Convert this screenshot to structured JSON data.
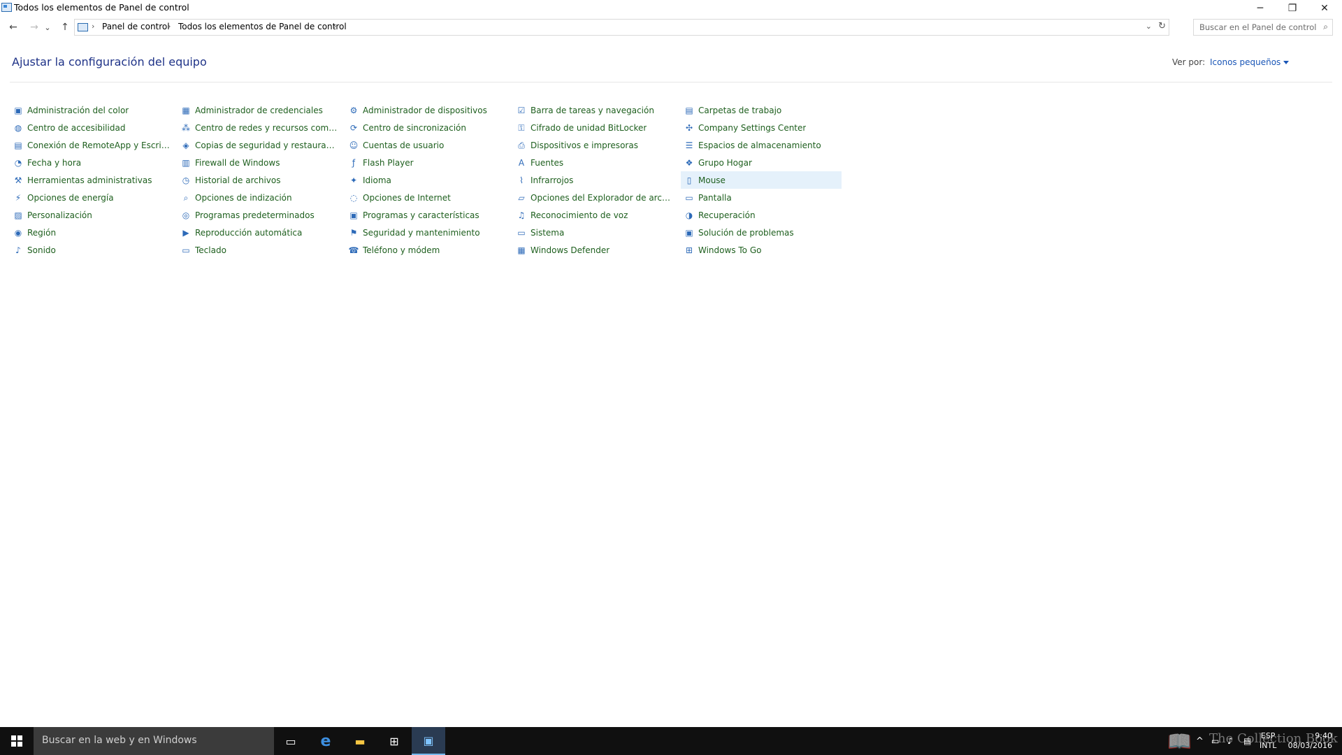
{
  "window": {
    "title": "Todos los elementos de Panel de control",
    "controls": {
      "minimize": "─",
      "maximize": "❐",
      "close": "✕"
    }
  },
  "nav": {
    "back": "←",
    "forward": "→",
    "recent": "⌄",
    "up": "↑",
    "breadcrumb": [
      "Panel de control",
      "Todos los elementos de Panel de control"
    ],
    "separator": "›",
    "dropdown": "⌄",
    "refresh": "↻",
    "search_placeholder": "Buscar en el Panel de control",
    "search_icon": "⌕"
  },
  "content": {
    "heading": "Ajustar la configuración del equipo",
    "view_by_label": "Ver por:",
    "view_by_value": "Iconos pequeños"
  },
  "items": {
    "col1": [
      {
        "label": "Administración del color",
        "icon": "color-management-icon",
        "glyph": "▣"
      },
      {
        "label": "Centro de accesibilidad",
        "icon": "accessibility-icon",
        "glyph": "◍"
      },
      {
        "label": "Conexión de RemoteApp y Escritorio",
        "icon": "remoteapp-icon",
        "glyph": "▤"
      },
      {
        "label": "Fecha y hora",
        "icon": "date-time-icon",
        "glyph": "◔"
      },
      {
        "label": "Herramientas administrativas",
        "icon": "admin-tools-icon",
        "glyph": "⚒"
      },
      {
        "label": "Opciones de energía",
        "icon": "power-options-icon",
        "glyph": "⚡"
      },
      {
        "label": "Personalización",
        "icon": "personalization-icon",
        "glyph": "▨"
      },
      {
        "label": "Región",
        "icon": "region-icon",
        "glyph": "◉"
      },
      {
        "label": "Sonido",
        "icon": "sound-icon",
        "glyph": "♪"
      }
    ],
    "col2": [
      {
        "label": "Administrador de credenciales",
        "icon": "credential-manager-icon",
        "glyph": "▦"
      },
      {
        "label": "Centro de redes y recursos comparti...",
        "icon": "network-center-icon",
        "glyph": "⁂"
      },
      {
        "label": "Copias de seguridad y restauración (...",
        "icon": "backup-restore-icon",
        "glyph": "◈"
      },
      {
        "label": "Firewall de Windows",
        "icon": "firewall-icon",
        "glyph": "▥"
      },
      {
        "label": "Historial de archivos",
        "icon": "file-history-icon",
        "glyph": "◷"
      },
      {
        "label": "Opciones de indización",
        "icon": "indexing-options-icon",
        "glyph": "⌕"
      },
      {
        "label": "Programas predeterminados",
        "icon": "default-programs-icon",
        "glyph": "◎"
      },
      {
        "label": "Reproducción automática",
        "icon": "autoplay-icon",
        "glyph": "▶"
      },
      {
        "label": "Teclado",
        "icon": "keyboard-icon",
        "glyph": "▭"
      }
    ],
    "col3": [
      {
        "label": "Administrador de dispositivos",
        "icon": "device-manager-icon",
        "glyph": "⚙"
      },
      {
        "label": "Centro de sincronización",
        "icon": "sync-center-icon",
        "glyph": "⟳"
      },
      {
        "label": "Cuentas de usuario",
        "icon": "user-accounts-icon",
        "glyph": "☺"
      },
      {
        "label": "Flash Player",
        "icon": "flash-player-icon",
        "glyph": "ƒ"
      },
      {
        "label": "Idioma",
        "icon": "language-icon",
        "glyph": "✦"
      },
      {
        "label": "Opciones de Internet",
        "icon": "internet-options-icon",
        "glyph": "◌"
      },
      {
        "label": "Programas y características",
        "icon": "programs-features-icon",
        "glyph": "▣"
      },
      {
        "label": "Seguridad y mantenimiento",
        "icon": "security-maintenance-icon",
        "glyph": "⚑"
      },
      {
        "label": "Teléfono y módem",
        "icon": "phone-modem-icon",
        "glyph": "☎"
      }
    ],
    "col4": [
      {
        "label": "Barra de tareas y navegación",
        "icon": "taskbar-navigation-icon",
        "glyph": "☑"
      },
      {
        "label": "Cifrado de unidad BitLocker",
        "icon": "bitlocker-icon",
        "glyph": "⚿"
      },
      {
        "label": "Dispositivos e impresoras",
        "icon": "devices-printers-icon",
        "glyph": "⎙"
      },
      {
        "label": "Fuentes",
        "icon": "fonts-icon",
        "glyph": "A"
      },
      {
        "label": "Infrarrojos",
        "icon": "infrared-icon",
        "glyph": "⌇"
      },
      {
        "label": "Opciones del Explorador de archivos",
        "icon": "explorer-options-icon",
        "glyph": "▱"
      },
      {
        "label": "Reconocimiento de voz",
        "icon": "speech-recognition-icon",
        "glyph": "♫"
      },
      {
        "label": "Sistema",
        "icon": "system-icon",
        "glyph": "▭"
      },
      {
        "label": "Windows Defender",
        "icon": "windows-defender-icon",
        "glyph": "▦"
      }
    ],
    "col5": [
      {
        "label": "Carpetas de trabajo",
        "icon": "work-folders-icon",
        "glyph": "▤"
      },
      {
        "label": "Company Settings Center",
        "icon": "company-settings-icon",
        "glyph": "✣"
      },
      {
        "label": "Espacios de almacenamiento",
        "icon": "storage-spaces-icon",
        "glyph": "☰"
      },
      {
        "label": "Grupo Hogar",
        "icon": "homegroup-icon",
        "glyph": "❖"
      },
      {
        "label": "Mouse",
        "icon": "mouse-icon",
        "glyph": "▯"
      },
      {
        "label": "Pantalla",
        "icon": "display-icon",
        "glyph": "▭"
      },
      {
        "label": "Recuperación",
        "icon": "recovery-icon",
        "glyph": "◑"
      },
      {
        "label": "Solución de problemas",
        "icon": "troubleshooting-icon",
        "glyph": "▣"
      },
      {
        "label": "Windows To Go",
        "icon": "windows-to-go-icon",
        "glyph": "⊞"
      }
    ]
  },
  "taskbar": {
    "search_placeholder": "Buscar en la web y en Windows",
    "task_view": "▭",
    "edge": "e",
    "explorer": "▬",
    "store": "⊞",
    "control_panel": "▣",
    "language": "ESP",
    "keyboard": "INTL",
    "time": "9:40",
    "date": "08/03/2016",
    "watermark": "The Collection Book"
  },
  "colors": {
    "link": "#1e5f1e",
    "heading": "#1e3287",
    "highlight": "#e5f1fb",
    "taskbar": "#101010"
  }
}
